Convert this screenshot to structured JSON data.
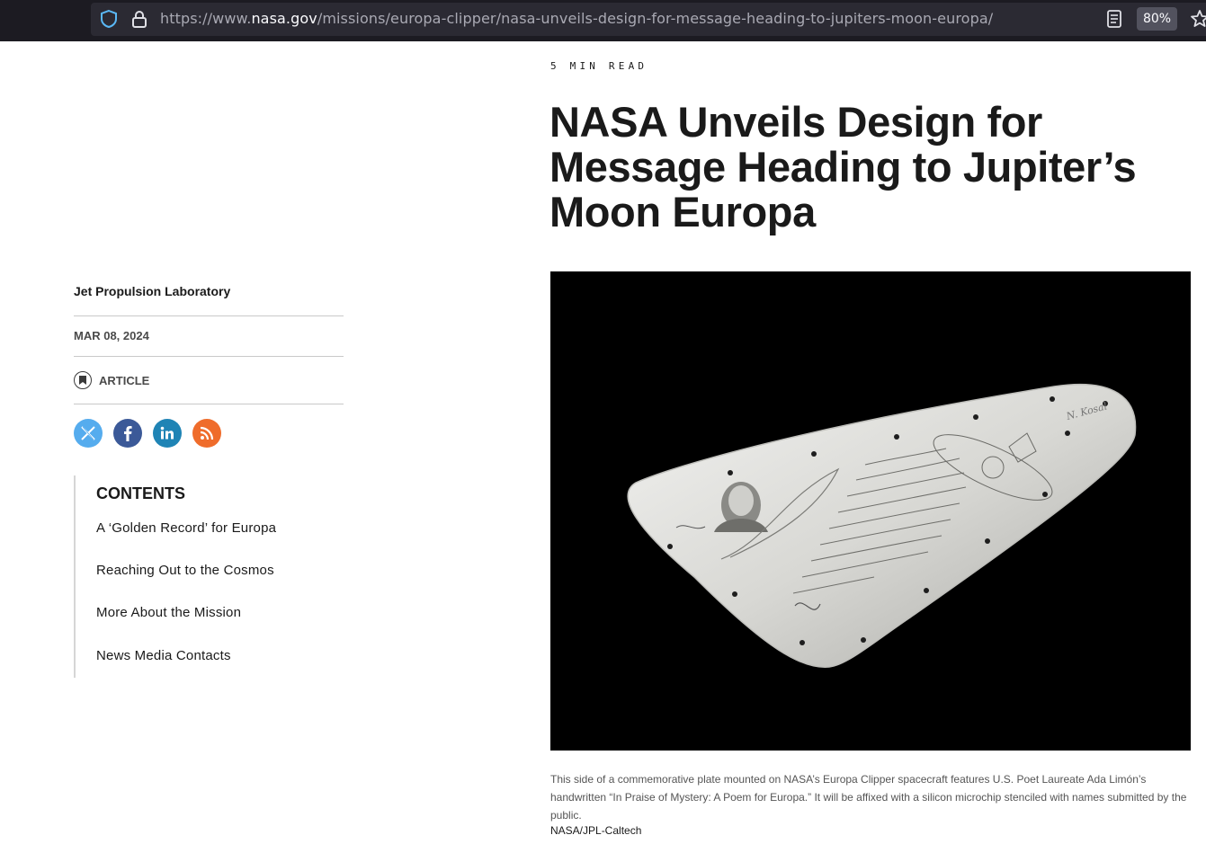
{
  "browser": {
    "url_prefix": "https://www.",
    "url_host": "nasa.gov",
    "url_path": "/missions/europa-clipper/nasa-unveils-design-for-message-heading-to-jupiters-moon-europa/",
    "zoom": "80%"
  },
  "article": {
    "read_time": "5 MIN READ",
    "title": "NASA Unveils Design for Message Heading to Jupiter’s Moon Europa",
    "author": "Jet Propulsion Laboratory",
    "date": "MAR 08, 2024",
    "type": "ARTICLE"
  },
  "contents": {
    "heading": "CONTENTS",
    "items": [
      "A ‘Golden Record’ for Europa",
      "Reaching Out to the Cosmos",
      "More About the Mission",
      "News Media Contacts"
    ]
  },
  "figure": {
    "plate_signature": "N. Kosal",
    "caption": "This side of a commemorative plate mounted on NASA’s Europa Clipper spacecraft features U.S. Poet Laureate Ada Limón’s handwritten “In Praise of Mystery: A Poem for Europa.” It will be affixed with a silicon microchip stenciled with names submitted by the public.",
    "credit": "NASA/JPL-Caltech"
  },
  "colors": {
    "x": "#55acee",
    "facebook": "#3b5998",
    "linkedin": "#1f84b5",
    "rss": "#ef6c2b"
  }
}
